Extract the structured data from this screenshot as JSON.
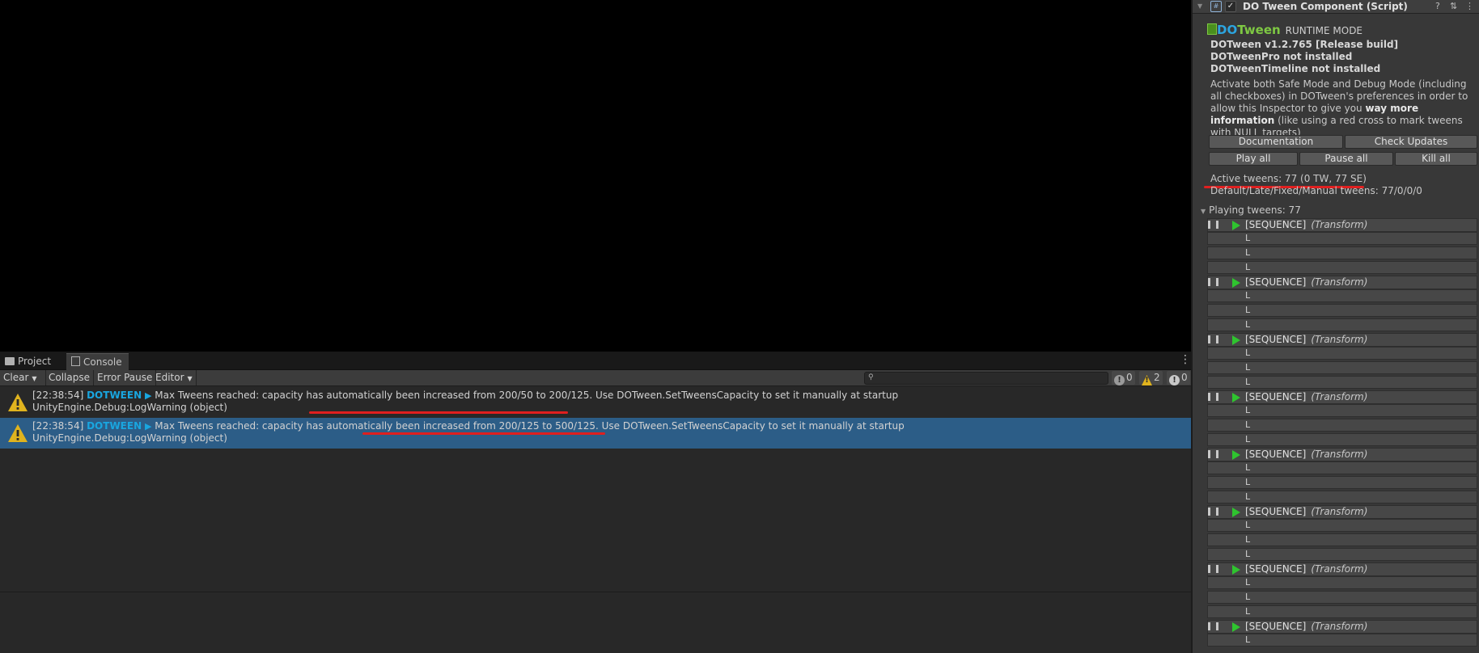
{
  "console": {
    "tabs": [
      {
        "label": "Project",
        "icon": "folder-icon"
      },
      {
        "label": "Console",
        "icon": "console-icon",
        "active": true
      }
    ],
    "toolbar": {
      "clear": "Clear",
      "collapse": "Collapse",
      "error_pause": "Error Pause",
      "editor": "Editor"
    },
    "counts": {
      "info": "0",
      "warnings": "2",
      "errors": "0"
    },
    "messages": [
      {
        "time": "[22:38:54]",
        "tag": "DOTWEEN",
        "text": "Max Tweens reached: capacity has automatically been increased from 200/50 to 200/125. Use DOTween.SetTweensCapacity to set it manually at startup",
        "line2": "UnityEngine.Debug:LogWarning (object)",
        "selected": false
      },
      {
        "time": "[22:38:54]",
        "tag": "DOTWEEN",
        "text": "Max Tweens reached: capacity has automatically been increased from 200/125 to 500/125. Use DOTween.SetTweensCapacity to set it manually at startup",
        "line2": "UnityEngine.Debug:LogWarning (object)",
        "selected": true
      }
    ]
  },
  "inspector": {
    "title": "DO Tween Component (Script)",
    "logo_do": "DO",
    "logo_tween": "Tween",
    "runtime_mode": "RUNTIME MODE",
    "version": "DOTween v1.2.765 [Release build]",
    "pro": "DOTweenPro not installed",
    "timeline": "DOTweenTimeline not installed",
    "desc_pre": "Activate both Safe Mode and Debug Mode (including all checkboxes) in DOTween's preferences in order to allow this Inspector to give you ",
    "desc_bold": "way more information",
    "desc_post": " (like using a red cross to mark tweens with NULL targets)",
    "buttons": {
      "documentation": "Documentation",
      "check_updates": "Check Updates",
      "play_all": "Play all",
      "pause_all": "Pause all",
      "kill_all": "Kill all"
    },
    "active_tweens": "Active tweens: 77 (0 TW, 77 SE)",
    "update_types": "Default/Late/Fixed/Manual tweens: 77/0/0/0",
    "playing_tweens": "Playing tweens: 77",
    "sequence_label": "[SEQUENCE]",
    "sequence_target": "(Transform)",
    "sub_glyph": "L"
  },
  "colors": {
    "selected_row": "#2c5d87",
    "dotween_tag": "#19a6e0",
    "underline": "#e01f1f",
    "play_green": "#2fc42f"
  }
}
